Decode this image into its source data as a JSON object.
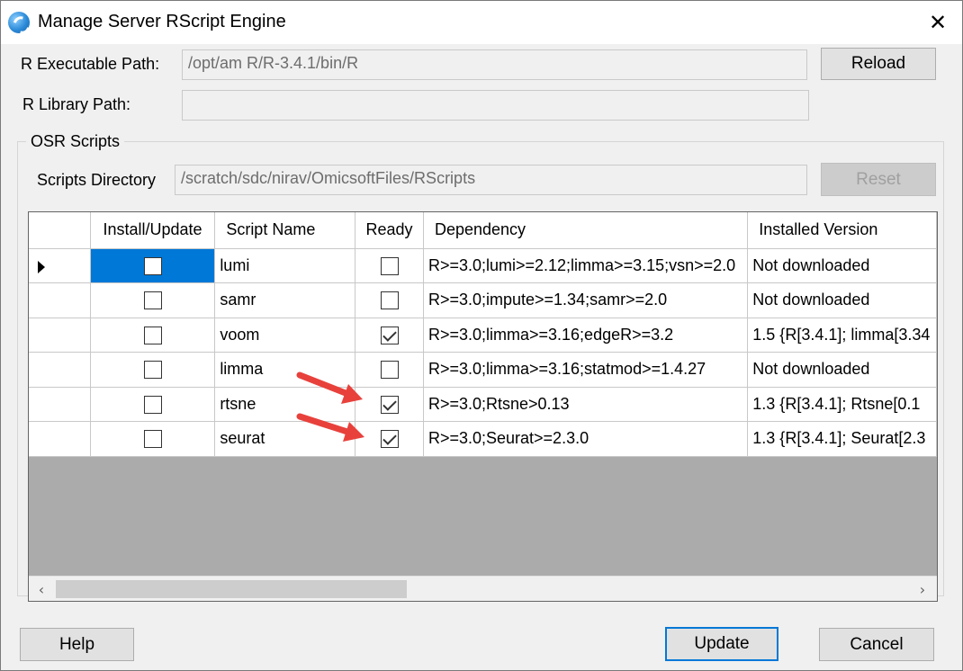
{
  "window": {
    "title": "Manage Server RScript Engine",
    "close_glyph": "✕"
  },
  "r_exec": {
    "label": "R Executable Path:",
    "value": "/opt/am       R/R-3.4.1/bin/R",
    "reload_label": "Reload"
  },
  "r_lib": {
    "label": "R Library Path:",
    "value": ""
  },
  "osr": {
    "group_label": "OSR Scripts",
    "dir_label": "Scripts Directory",
    "dir_value": "/scratch/sdc/nirav/OmicsoftFiles/RScripts",
    "reset_label": "Reset"
  },
  "grid": {
    "columns": [
      "Install/Update",
      "Script Name",
      "Ready",
      "Dependency",
      "Installed Version"
    ],
    "rows": [
      {
        "install": false,
        "name": "lumi",
        "ready": false,
        "dependency": "R>=3.0;lumi>=2.12;limma>=3.15;vsn>=2.0",
        "version": "Not downloaded"
      },
      {
        "install": false,
        "name": "samr",
        "ready": false,
        "dependency": "R>=3.0;impute>=1.34;samr>=2.0",
        "version": "Not downloaded"
      },
      {
        "install": false,
        "name": "voom",
        "ready": true,
        "dependency": "R>=3.0;limma>=3.16;edgeR>=3.2",
        "version": "1.5 {R[3.4.1]; limma[3.34"
      },
      {
        "install": false,
        "name": "limma",
        "ready": false,
        "dependency": "R>=3.0;limma>=3.16;statmod>=1.4.27",
        "version": "Not downloaded"
      },
      {
        "install": false,
        "name": "rtsne",
        "ready": true,
        "dependency": "R>=3.0;Rtsne>0.13",
        "version": "1.3 {R[3.4.1]; Rtsne[0.1"
      },
      {
        "install": false,
        "name": "seurat",
        "ready": true,
        "dependency": "R>=3.0;Seurat>=2.3.0",
        "version": "1.3 {R[3.4.1]; Seurat[2.3"
      }
    ]
  },
  "scroll": {
    "left_glyph": "‹",
    "right_glyph": "›"
  },
  "footer": {
    "help_label": "Help",
    "update_label": "Update",
    "cancel_label": "Cancel"
  },
  "colors": {
    "selection": "#0078d7",
    "annotation_arrow": "#e8413c",
    "grid_empty": "#ababab"
  }
}
